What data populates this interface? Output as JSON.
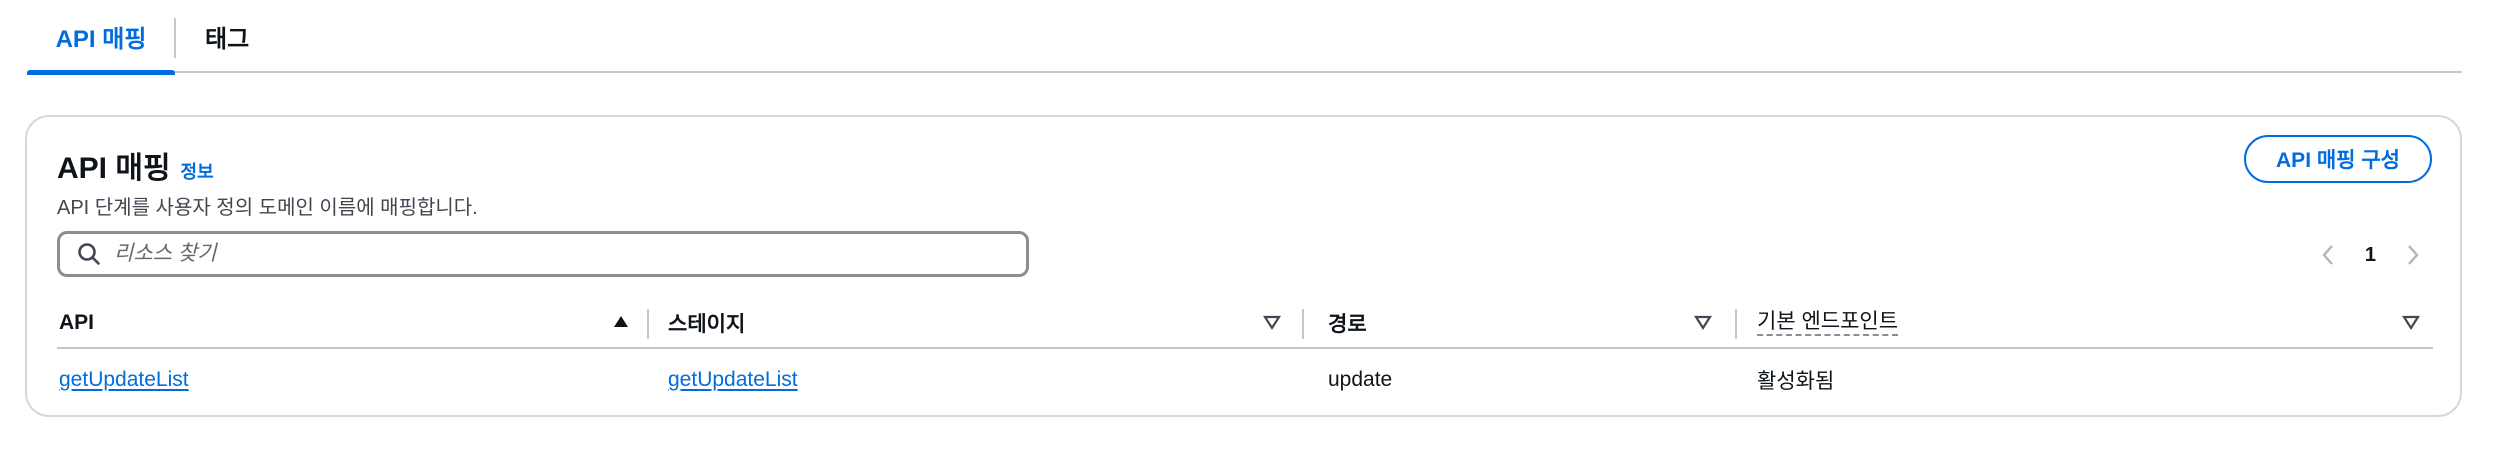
{
  "tabs": [
    {
      "label": "API 매핑",
      "active": true
    },
    {
      "label": "태그",
      "active": false
    }
  ],
  "section": {
    "title": "API 매핑",
    "info_link": "정보",
    "description": "API 단계를 사용자 정의 도메인 이름에 매핑합니다.",
    "configure_button": "API 매핑 구성"
  },
  "search": {
    "placeholder": "리소스 찾기",
    "value": ""
  },
  "pagination": {
    "current_page": "1"
  },
  "table": {
    "columns": [
      {
        "label": "API",
        "sort": "ascending"
      },
      {
        "label": "스테이지",
        "sort": "none"
      },
      {
        "label": "경로",
        "sort": "none"
      },
      {
        "label": "기본 엔드포인트",
        "sort": "none",
        "has_tooltip": true
      }
    ],
    "rows": [
      {
        "api": "getUpdateList",
        "stage": "getUpdateList",
        "path": "update",
        "default_endpoint": "활성화됨"
      }
    ]
  },
  "colors": {
    "accent": "#006ce0",
    "border": "#c6c6cd",
    "text": "#0f141a",
    "muted": "#424650"
  },
  "icons": [
    "search-icon",
    "chevron-left-icon",
    "chevron-right-icon",
    "sort-ascending-icon",
    "sort-descending-icon"
  ]
}
